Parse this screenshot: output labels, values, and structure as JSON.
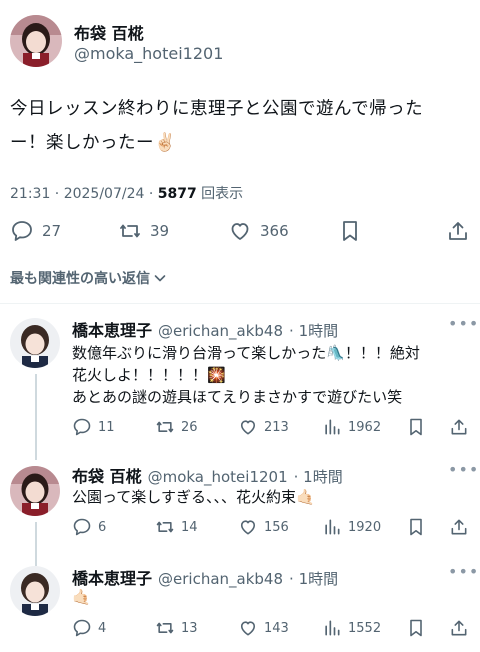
{
  "main_tweet": {
    "author": "布袋 百椛",
    "handle": "@moka_hotei1201",
    "text_line1": "今日レッスン終わりに恵理子と公園で遊んで帰った",
    "text_line2": "ー！楽しかったー",
    "emoji": "✌🏻",
    "time": "21:31 · 2025/07/24 · ",
    "views": "5877",
    "views_label": "回表示",
    "replies": "27",
    "retweets": "39",
    "likes": "366"
  },
  "sort_label": "最も関連性の高い返信",
  "replies": [
    {
      "author": "橋本恵理子",
      "handle": "@erichan_akb48",
      "time": "· 1時間",
      "text_line1": "数億年ぶりに滑り台滑って楽しかった🛝！！！絶対",
      "text_line2": "花火しよ！！！！！🎇",
      "text_line3": "あとあの謎の遊具ほてえりまさかすで遊びたい笑",
      "replies": "11",
      "retweets": "26",
      "likes": "213",
      "views": "1962"
    },
    {
      "author": "布袋 百椛",
      "handle": "@moka_hotei1201",
      "time": "· 1時間",
      "text_line1": "公園って楽しすぎる、、、花火約束🤙🏻",
      "replies": "6",
      "retweets": "14",
      "likes": "156",
      "views": "1920"
    },
    {
      "author": "橋本恵理子",
      "handle": "@erichan_akb48",
      "time": "· 1時間",
      "text_line1": "🤙🏻",
      "replies": "4",
      "retweets": "13",
      "likes": "143",
      "views": "1552"
    }
  ],
  "colors": {
    "text": "#0f1419",
    "secondary": "#536471",
    "thread_line": "#cfd9de"
  }
}
